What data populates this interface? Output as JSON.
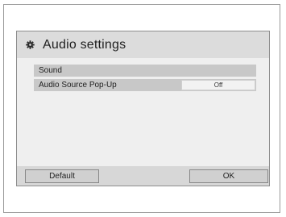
{
  "dialog": {
    "title": "Audio settings",
    "title_icon": "gear-icon"
  },
  "settings": {
    "sound_label": "Sound",
    "audio_source_popup": {
      "label": "Audio Source Pop-Up",
      "value": "Off"
    }
  },
  "buttons": {
    "default_label": "Default",
    "ok_label": "OK"
  }
}
